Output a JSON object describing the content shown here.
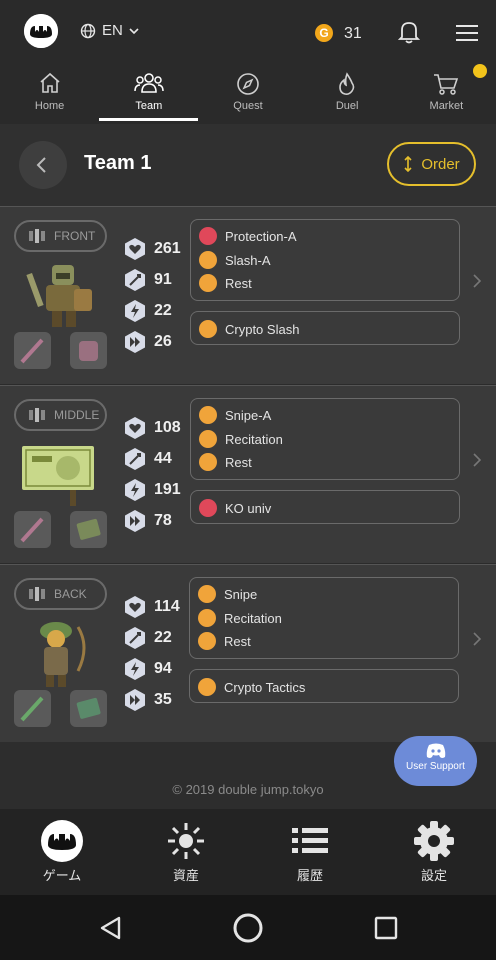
{
  "header": {
    "language": "EN",
    "coin_symbol": "G",
    "coin_count": "31"
  },
  "nav_tabs": [
    {
      "label": "Home"
    },
    {
      "label": "Team"
    },
    {
      "label": "Quest"
    },
    {
      "label": "Duel"
    },
    {
      "label": "Market"
    }
  ],
  "team": {
    "title": "Team 1",
    "order_label": "Order"
  },
  "rows": [
    {
      "position": "FRONT",
      "stats": {
        "hp": "261",
        "atk": "91",
        "spd": "22",
        "agi": "26"
      },
      "skills": [
        "Protection-A",
        "Slash-A",
        "Rest"
      ],
      "extra_skill": "Crypto Slash"
    },
    {
      "position": "MIDDLE",
      "stats": {
        "hp": "108",
        "atk": "44",
        "spd": "191",
        "agi": "78"
      },
      "skills": [
        "Snipe-A",
        "Recitation",
        "Rest"
      ],
      "extra_skill": "KO univ"
    },
    {
      "position": "BACK",
      "stats": {
        "hp": "114",
        "atk": "22",
        "spd": "94",
        "agi": "35"
      },
      "skills": [
        "Snipe",
        "Recitation",
        "Rest"
      ],
      "extra_skill": "Crypto Tactics"
    }
  ],
  "footer": {
    "copyright": "© 2019 double jump.tokyo",
    "support_label": "User Support"
  },
  "bottom_nav": [
    {
      "label": "ゲーム"
    },
    {
      "label": "資産"
    },
    {
      "label": "履歴"
    },
    {
      "label": "設定"
    }
  ],
  "colors": {
    "accent_gold": "#e5bf2c",
    "skill_orange": "#f0a43a",
    "skill_red": "#e0485a",
    "support_blue": "#6d8bd8"
  }
}
